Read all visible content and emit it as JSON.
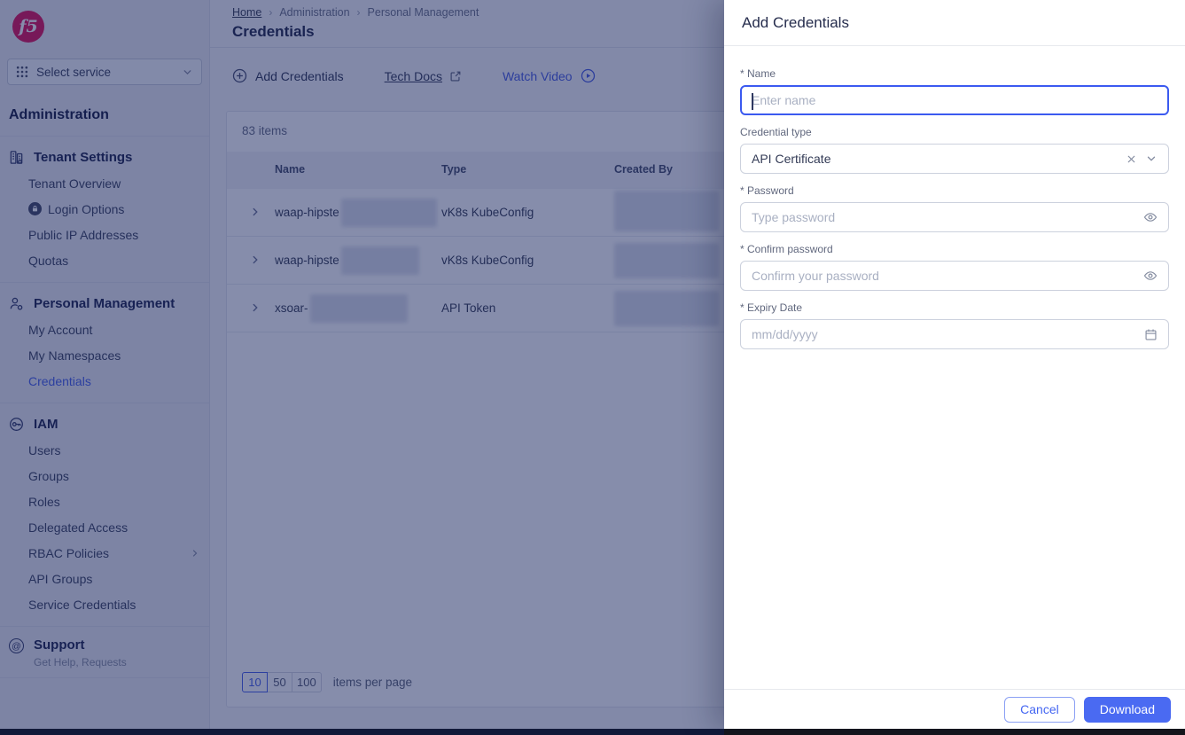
{
  "colors": {
    "accent": "#4a63e8",
    "brand": "#e0175b",
    "download_bg": "#4a6af2",
    "overlay": "rgba(13,27,87,0.5)"
  },
  "sidebar": {
    "logo_text": "f5",
    "service_selector_label": "Select service",
    "title": "Administration",
    "sections": [
      {
        "label": "Tenant Settings",
        "items": [
          {
            "label": "Tenant Overview"
          },
          {
            "label": "Login Options"
          },
          {
            "label": "Public IP Addresses"
          },
          {
            "label": "Quotas"
          }
        ]
      },
      {
        "label": "Personal Management",
        "items": [
          {
            "label": "My Account"
          },
          {
            "label": "My Namespaces"
          },
          {
            "label": "Credentials",
            "active": true
          }
        ]
      },
      {
        "label": "IAM",
        "items": [
          {
            "label": "Users"
          },
          {
            "label": "Groups"
          },
          {
            "label": "Roles"
          },
          {
            "label": "Delegated Access"
          },
          {
            "label": "RBAC Policies",
            "has_submenu": true
          },
          {
            "label": "API Groups"
          },
          {
            "label": "Service Credentials"
          }
        ]
      }
    ],
    "support": {
      "label": "Support",
      "sublabel": "Get Help, Requests"
    }
  },
  "breadcrumb": {
    "items": [
      "Home",
      "Administration",
      "Personal Management"
    ]
  },
  "page": {
    "title": "Credentials"
  },
  "toolbar": {
    "add_button": "Add Credentials",
    "tech_docs": "Tech Docs",
    "watch_video": "Watch Video"
  },
  "table": {
    "count": "83 items",
    "columns": [
      "Name",
      "Type",
      "Created By"
    ],
    "rows": [
      {
        "name_prefix": "waap-hipste",
        "name_redacted": true,
        "type": "vK8s KubeConfig",
        "created_by_redacted": true
      },
      {
        "name_prefix": "waap-hipste",
        "name_redacted": true,
        "type": "vK8s KubeConfig",
        "created_by_redacted": true
      },
      {
        "name_prefix": "xsoar-",
        "name_redacted": true,
        "type": "API Token",
        "created_by_redacted": true
      }
    ],
    "pagination": {
      "options": [
        "10",
        "50",
        "100"
      ],
      "selected": "10",
      "label": "items per page"
    }
  },
  "drawer": {
    "title": "Add Credentials",
    "fields": {
      "name": {
        "label": "* Name",
        "placeholder": "Enter name",
        "value": ""
      },
      "credential_type": {
        "label": "Credential type",
        "value": "API Certificate"
      },
      "password": {
        "label": "* Password",
        "placeholder": "Type password",
        "value": ""
      },
      "confirm_password": {
        "label": "* Confirm password",
        "placeholder": "Confirm your password",
        "value": ""
      },
      "expiry": {
        "label": "* Expiry Date",
        "placeholder": "mm/dd/yyyy",
        "value": ""
      }
    },
    "actions": {
      "cancel": "Cancel",
      "download": "Download"
    }
  }
}
